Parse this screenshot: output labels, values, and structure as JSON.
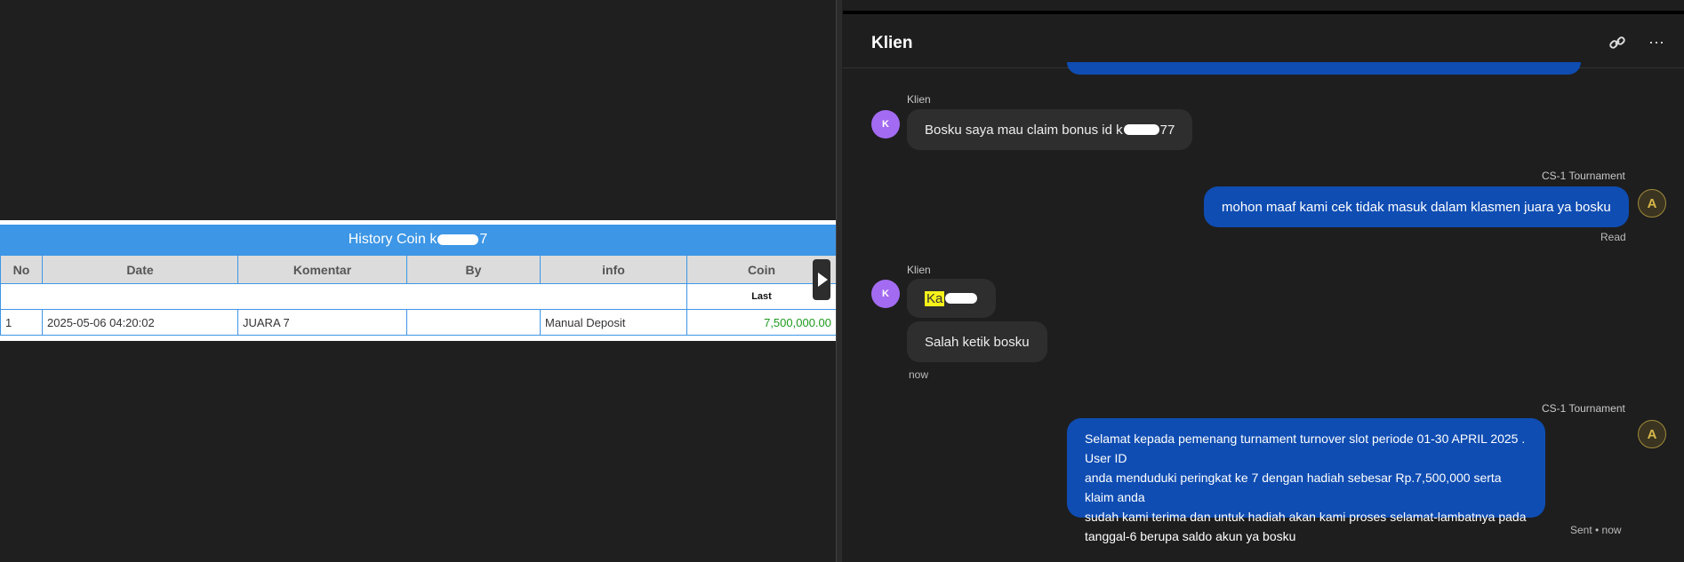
{
  "history": {
    "title_prefix": "History Coin k",
    "title_suffix": "7",
    "columns": [
      "No",
      "Date",
      "Komentar",
      "By",
      "info",
      "Coin"
    ],
    "sub_header": "Last",
    "rows": [
      {
        "no": "1",
        "date": "2025-05-06 04:20:02",
        "komentar": "JUARA 7",
        "by": "",
        "info": "Manual Deposit",
        "coin": "7,500,000.00"
      }
    ]
  },
  "chat": {
    "title": "Klien",
    "icons": [
      "link-icon",
      "more-icon"
    ],
    "messages": [
      {
        "sender": "Klien",
        "avatar": "K",
        "text_prefix": "Bosku saya mau claim bonus id k",
        "text_suffix": "77"
      },
      {
        "sender": "CS-1 Tournament",
        "avatar": "A",
        "text": "mohon maaf kami cek tidak masuk dalam klasmen juara ya bosku",
        "status": "Read"
      },
      {
        "sender": "Klien",
        "avatar": "K",
        "text_highlight": "Ka",
        "text2": "Salah ketik bosku",
        "time": "now"
      },
      {
        "sender": "CS-1 Tournament",
        "avatar": "A",
        "lines": [
          "Selamat kepada pemenang turnament turnover slot periode 01-30 APRIL 2025 . User ID",
          "anda menduduki peringkat ke 7 dengan hadiah sebesar Rp.7,500,000 serta klaim anda",
          "sudah kami terima dan untuk hadiah akan kami proses selamat-lambatnya pada",
          "tanggal-6 berupa saldo akun ya bosku"
        ],
        "status": "Sent • now"
      }
    ]
  },
  "colors": {
    "accent": "#3d96e6",
    "bubble_out": "#0f4db3",
    "bubble_in": "#2e2e2e",
    "avatar_k": "#a36bf2",
    "coin_green": "#1d9a1d"
  }
}
